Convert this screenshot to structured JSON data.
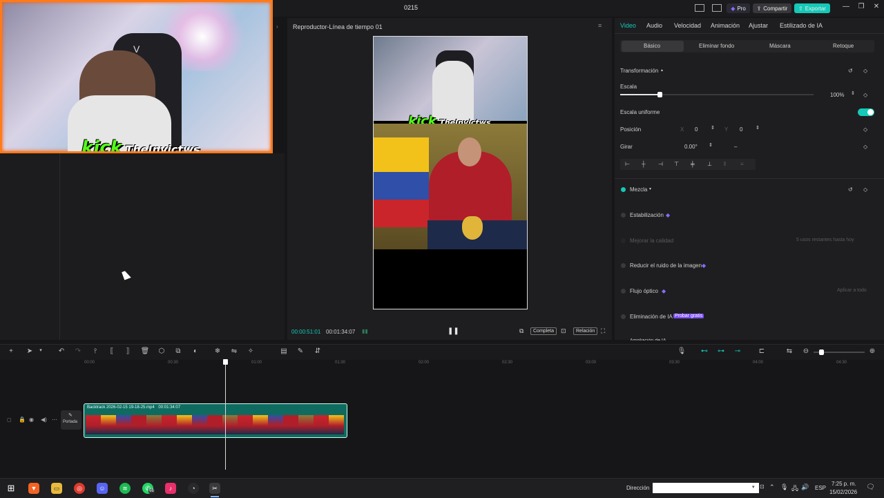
{
  "titlebar": {
    "project_name": "0215",
    "pro_label": "Pro",
    "share_label": "Compartir",
    "export_label": "Exportar",
    "colors": {
      "export": "#14c9b8",
      "pro": "#8a6cff"
    }
  },
  "webcam": {
    "brand": "kick",
    "channel": "TheInvictws"
  },
  "player": {
    "title": "Reproductor-Línea de tiempo 01",
    "current_time": "00:00:51:01",
    "total_time": "00:01:34:07",
    "btn_full": "Completa",
    "btn_ratio": "Relación",
    "preview_brand": "kick",
    "preview_channel": "TheInvictws"
  },
  "right_panel": {
    "tabs": [
      "Video",
      "Audio",
      "Velocidad",
      "Animación",
      "Ajustar",
      "Estilizado de IA"
    ],
    "subtabs": [
      "Básico",
      "Eliminar fondo",
      "Máscara",
      "Retoque"
    ],
    "transform_label": "Transformación",
    "scale_label": "Escala",
    "scale_value": "100%",
    "uniform_scale_label": "Escala uniforme",
    "position_label": "Posición",
    "pos_x_label": "X",
    "pos_x": "0",
    "pos_y_label": "Y",
    "pos_y": "0",
    "rotate_label": "Girar",
    "rotate_value": "0.00°",
    "blend_label": "Mezcla",
    "stabilize_label": "Estabilización",
    "quality_label": "Mejorar la calidad",
    "quality_hint": "5 usos restantes hasta hoy",
    "denoise_label": "Reducir el ruido de la imagen",
    "flow_label": "Flujo óptico",
    "apply_all": "Aplicar a todo",
    "ai_remove_label": "Eliminación de IA",
    "ai_remove_badge": "Probar gratis",
    "ai_expand_label": "Ampliación de IA",
    "accent": "#14c9b8"
  },
  "timeline": {
    "ruler_ticks": [
      "00:00",
      "00:30",
      "01:00",
      "01:30",
      "02:00",
      "02:30",
      "03:00",
      "03:30",
      "04:00",
      "04:30"
    ],
    "cover_label": "Portada",
    "clip_name": "Backtrack 2026-02-15 19-18-25.mp4",
    "clip_duration": "00:01:34:07"
  },
  "taskbar": {
    "address_label": "Dirección",
    "lang": "ESP",
    "time": "7:25 p. m.",
    "date": "15/02/2026",
    "whatsapp_badge": "66"
  }
}
